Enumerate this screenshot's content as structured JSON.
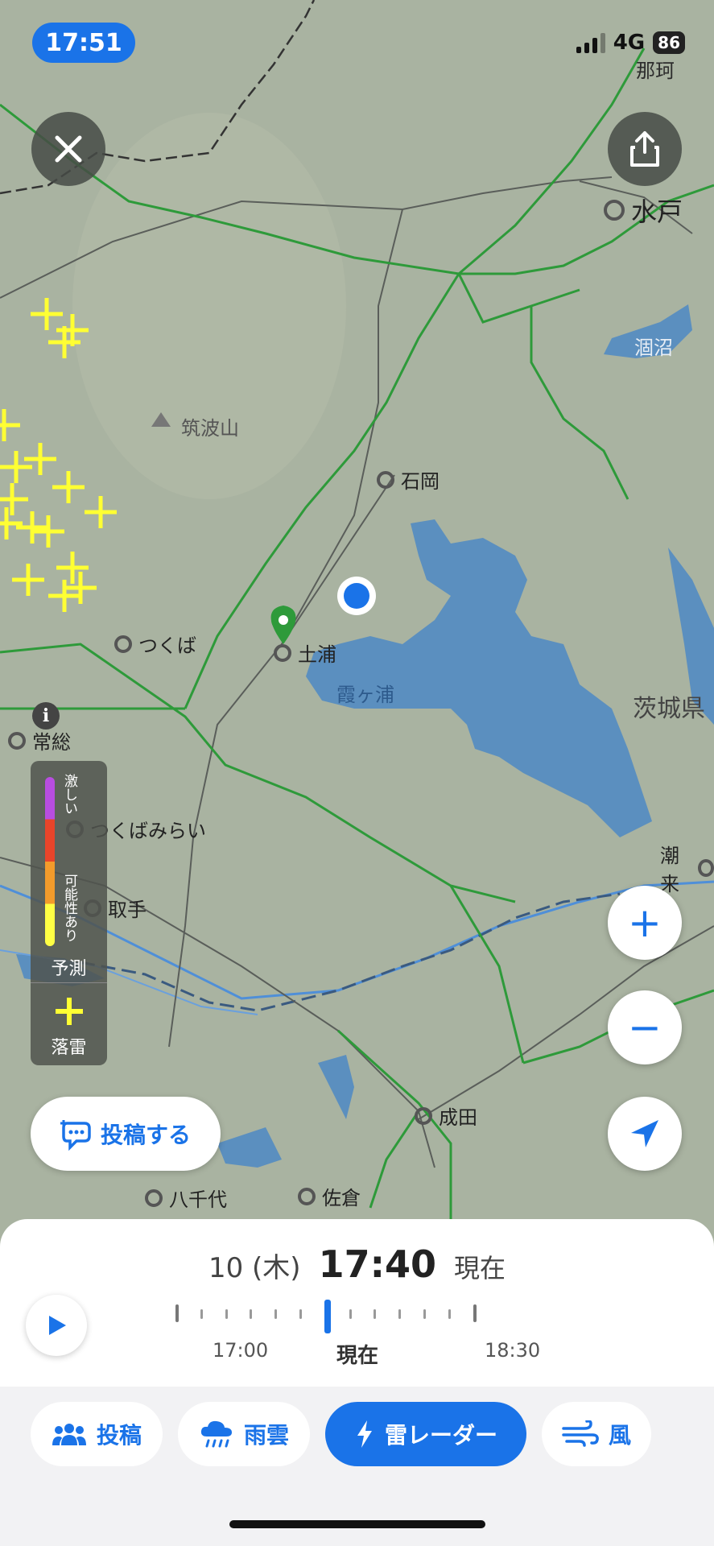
{
  "status_bar": {
    "time": "17:51",
    "network": "4G",
    "battery": "86"
  },
  "map": {
    "labels": [
      {
        "name": "place-mito",
        "text": "水戸"
      },
      {
        "name": "place-naka",
        "text": "那珂"
      },
      {
        "name": "place-hinuma",
        "text": "涸沼"
      },
      {
        "name": "place-tsukubasan",
        "text": "筑波山"
      },
      {
        "name": "place-ishioka",
        "text": "石岡"
      },
      {
        "name": "place-tsukuba",
        "text": "つくば"
      },
      {
        "name": "place-tsuchiura",
        "text": "土浦"
      },
      {
        "name": "place-kasumigaura",
        "text": "霞ヶ浦"
      },
      {
        "name": "place-ibaraki",
        "text": "茨城県"
      },
      {
        "name": "place-joso",
        "text": "常総"
      },
      {
        "name": "place-tsukubamirai",
        "text": "つくばみらい"
      },
      {
        "name": "place-toride",
        "text": "取手"
      },
      {
        "name": "place-itako",
        "text": "潮来"
      },
      {
        "name": "place-narita",
        "text": "成田"
      },
      {
        "name": "place-yachiyo",
        "text": "八千代"
      },
      {
        "name": "place-sakura",
        "text": "佐倉"
      }
    ],
    "colors": {
      "lake": "#5b8fbf",
      "rail": "#2e9a3a",
      "lightning": "#ffff33",
      "location": "#1a73e8",
      "pin": "#2e9a3a"
    }
  },
  "legend": {
    "strong": "激しい",
    "possible": "可能性あり",
    "forecast": "予測",
    "strike": "落雷",
    "gradient": [
      "#b84de0",
      "#e8442a",
      "#f39b2b",
      "#ffff44"
    ]
  },
  "post_button": {
    "label": "投稿する"
  },
  "controls": {
    "zoom_in": "+",
    "zoom_out": "−"
  },
  "timeline": {
    "date": "10 (木)",
    "time": "17:40",
    "now_label": "現在",
    "ticks": [
      "17:00",
      "現在",
      "18:30"
    ]
  },
  "tabs": [
    {
      "label": "投稿",
      "icon": "people-icon",
      "active": false
    },
    {
      "label": "雨雲",
      "icon": "rain-cloud-icon",
      "active": false
    },
    {
      "label": "雷レーダー",
      "icon": "lightning-icon",
      "active": true
    },
    {
      "label": "風",
      "icon": "wind-icon",
      "active": false
    }
  ]
}
